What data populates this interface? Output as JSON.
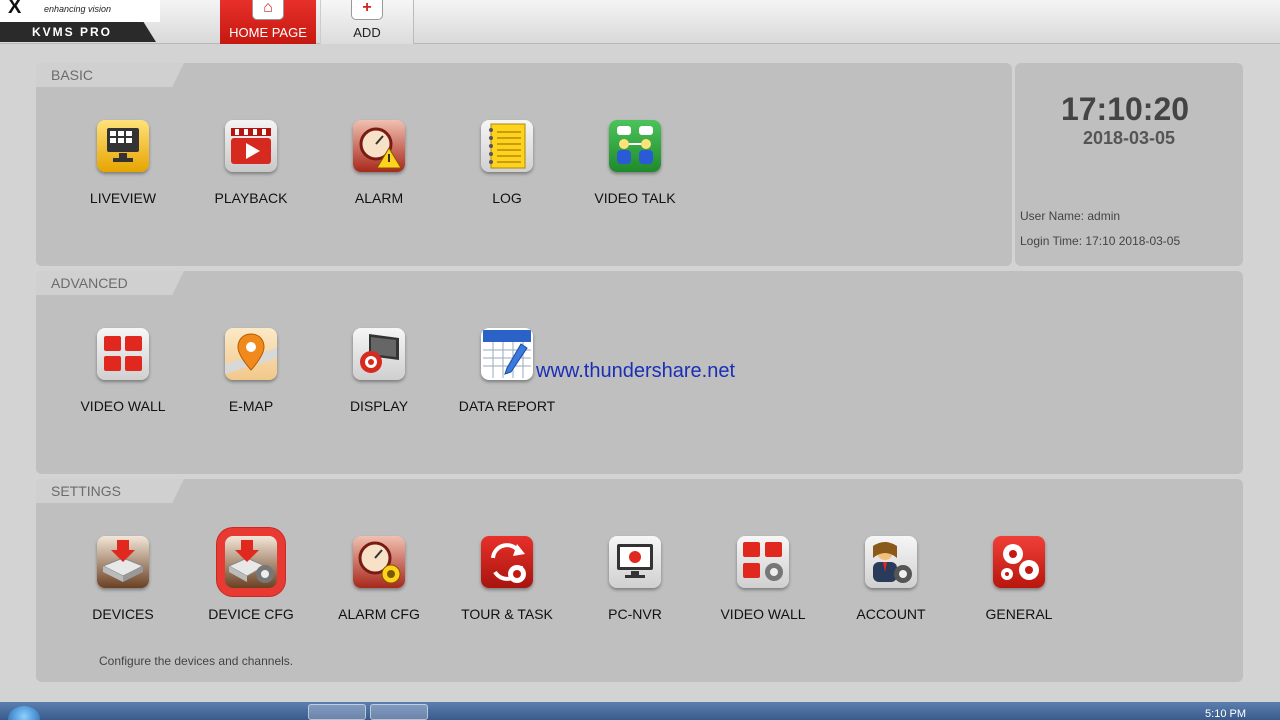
{
  "app": {
    "logo_mark": "X",
    "logo_tagline": "enhancing vision",
    "logo_name": "KVMS PRO"
  },
  "topnav": [
    {
      "label": "HOME PAGE",
      "icon": "home-icon"
    },
    {
      "label": "ADD",
      "icon": "plus-icon"
    }
  ],
  "basic": {
    "title": "BASIC",
    "tiles": [
      {
        "label": "LIVEVIEW",
        "icon": "liveview-grid-icon"
      },
      {
        "label": "PLAYBACK",
        "icon": "clapperboard-play-icon"
      },
      {
        "label": "ALARM",
        "icon": "alarm-warning-icon"
      },
      {
        "label": "LOG",
        "icon": "notepad-icon"
      },
      {
        "label": "VIDEO TALK",
        "icon": "users-talk-icon"
      }
    ]
  },
  "info": {
    "time": "17:10:20",
    "date": "2018-03-05",
    "user_label": "User Name:",
    "user_value": "admin",
    "login_label": "Login Time:",
    "login_value": "17:10 2018-03-05"
  },
  "advanced": {
    "title": "ADVANCED",
    "tiles": [
      {
        "label": "VIDEO WALL",
        "icon": "video-wall-icon"
      },
      {
        "label": "E-MAP",
        "icon": "map-pin-icon"
      },
      {
        "label": "DISPLAY",
        "icon": "display-settings-icon"
      },
      {
        "label": "DATA REPORT",
        "icon": "calendar-report-icon"
      }
    ]
  },
  "watermark": "www.thundershare.net",
  "settings": {
    "title": "SETTINGS",
    "description": "Configure the devices and channels.",
    "tiles": [
      {
        "label": "DEVICES",
        "icon": "device-download-icon"
      },
      {
        "label": "DEVICE CFG",
        "icon": "device-config-icon",
        "selected": true
      },
      {
        "label": "ALARM CFG",
        "icon": "alarm-config-icon"
      },
      {
        "label": "TOUR & TASK",
        "icon": "tour-task-icon"
      },
      {
        "label": "PC-NVR",
        "icon": "pc-nvr-icon"
      },
      {
        "label": "VIDEO WALL",
        "icon": "video-wall-config-icon"
      },
      {
        "label": "ACCOUNT",
        "icon": "account-icon"
      },
      {
        "label": "GENERAL",
        "icon": "gears-icon"
      }
    ]
  },
  "taskbar": {
    "time": "5:10 PM"
  },
  "colors": {
    "accent": "#d0241b",
    "panel": "#bfbfbf",
    "background": "#d3d3d3",
    "watermark": "#1a2fb5"
  }
}
